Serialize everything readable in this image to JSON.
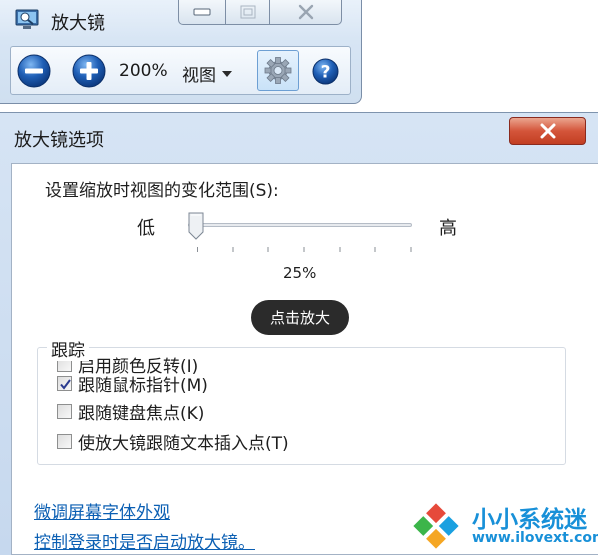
{
  "magnifier": {
    "title": "放大镜",
    "icons": [
      "magnifier-app-icon",
      "minimize-icon",
      "maximize-icon",
      "close-icon",
      "zoom-out-icon",
      "zoom-in-icon",
      "gear-icon",
      "help-icon"
    ],
    "zoom_level": "200%",
    "view_menu": "视图"
  },
  "options": {
    "title": "放大镜选项",
    "range_label": "设置缩放时视图的变化范围(S):",
    "low_label": "低",
    "high_label": "高",
    "slider_percent": "25%",
    "slider_value": 0,
    "color_inversion_label": "启用颜色反转(I)",
    "color_inversion_checked": false,
    "tooltip": "点击放大",
    "tracking_group_label": "跟踪",
    "tracking": [
      {
        "label": "跟随鼠标指针(M)",
        "checked": true
      },
      {
        "label": "跟随键盘焦点(K)",
        "checked": false
      },
      {
        "label": "使放大镜跟随文本插入点(T)",
        "checked": false
      }
    ],
    "link_fonts": "微调屏幕字体外观",
    "link_logon": "控制登录时是否启动放大镜。"
  },
  "watermark": {
    "title": "小小系统迷",
    "url": "www.ilovext.com"
  },
  "colors": {
    "link": "#0b5fb3",
    "close_red": "#c23e22",
    "watermark_blue": "#1890d8",
    "title_bar": "#d7e5f4"
  }
}
